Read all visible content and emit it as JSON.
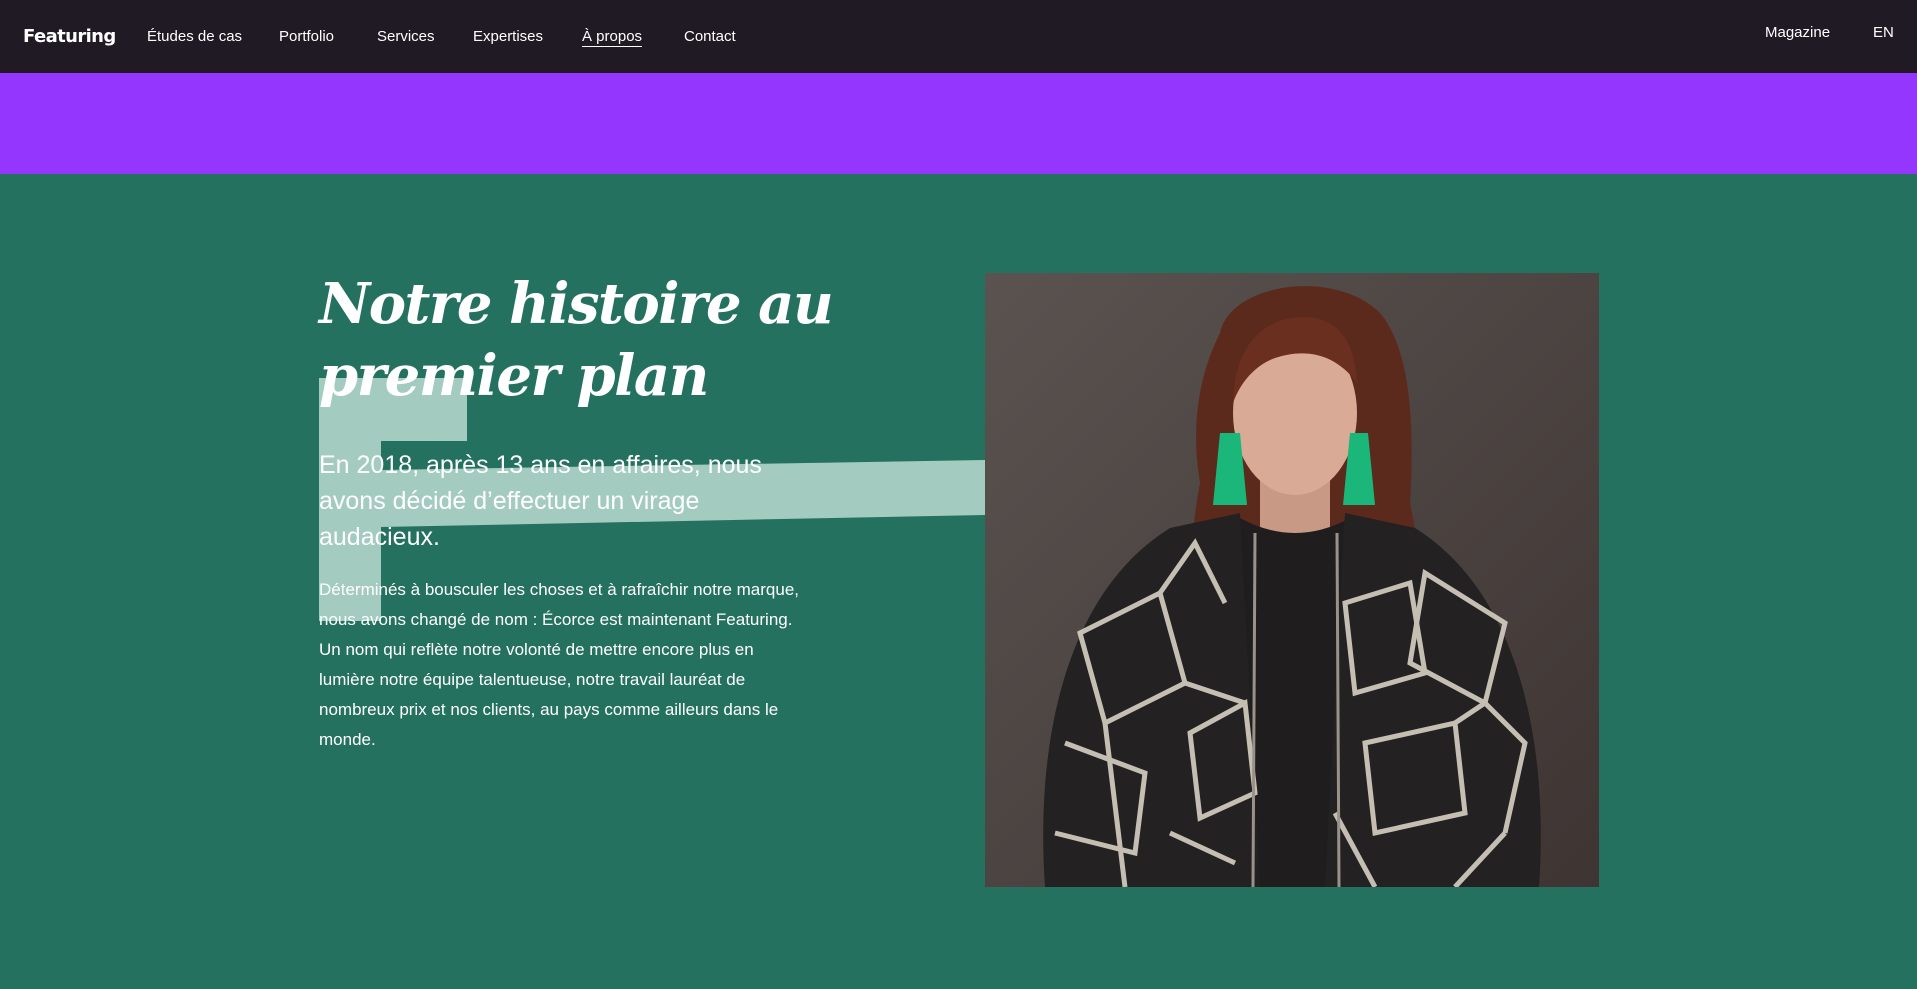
{
  "nav": {
    "logo": "Featuring",
    "items": [
      {
        "label": "Études de cas"
      },
      {
        "label": "Portfolio"
      },
      {
        "label": "Services"
      },
      {
        "label": "Expertises"
      },
      {
        "label": "À propos"
      },
      {
        "label": "Contact"
      }
    ],
    "active": "À propos",
    "magazine": "Magazine",
    "language": "EN"
  },
  "colors": {
    "nav_background": "#1f1a24",
    "accent_band": "#9436fe",
    "section_background": "#24715f",
    "decorative_shape": "#a4cbbf"
  },
  "story": {
    "title": "Notre histoire au premier plan",
    "lead": "En 2018, après 13 ans en affaires, nous avons décidé d’effectuer un virage audacieux.",
    "body": "Déterminés à bousculer les choses et à rafraîchir notre marque, nous avons changé de nom : Écorce est maintenant Featuring. Un nom qui reflète notre volonté de mettre encore plus en lumière notre équipe talentueuse, notre travail lauréat de nombreux prix et nos clients, au pays comme ailleurs dans le monde."
  }
}
